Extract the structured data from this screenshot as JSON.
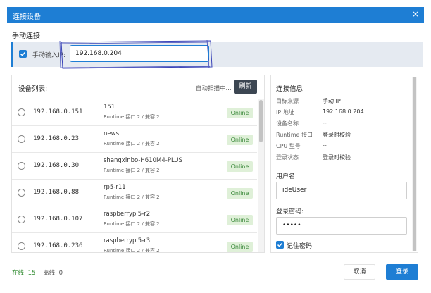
{
  "window": {
    "title": "连接设备",
    "close_glyph": "×"
  },
  "manual": {
    "section_title": "手动连接",
    "checkbox_label": "手动输入IP:",
    "checked": true,
    "ip_value": "192.168.0.204"
  },
  "device_list": {
    "header": "设备列表:",
    "scan_status": "自动扫描中...",
    "refresh_label": "刷新",
    "devices": [
      {
        "ip": "192.168.0.151",
        "name": "151",
        "sub": "Runtime 接口 2 / 兼容 2",
        "status": "Online"
      },
      {
        "ip": "192.168.0.23",
        "name": "news",
        "sub": "Runtime 接口 2 / 兼容 2",
        "status": "Online"
      },
      {
        "ip": "192.168.0.30",
        "name": "shangxinbo-H610M4-PLUS",
        "sub": "Runtime 接口 2 / 兼容 2",
        "status": "Online"
      },
      {
        "ip": "192.168.0.88",
        "name": "rp5-r11",
        "sub": "Runtime 接口 2 / 兼容 2",
        "status": "Online"
      },
      {
        "ip": "192.168.0.107",
        "name": "raspberrypi5-r2",
        "sub": "Runtime 接口 2 / 兼容 2",
        "status": "Online"
      },
      {
        "ip": "192.168.0.236",
        "name": "raspberrypi5-r3",
        "sub": "Runtime 接口 2 / 兼容 2",
        "status": "Online"
      }
    ]
  },
  "connection_info": {
    "header": "连接信息",
    "rows": [
      {
        "key": "目标来源",
        "value": "手动 IP"
      },
      {
        "key": "IP 地址",
        "value": "192.168.0.204"
      },
      {
        "key": "设备名称",
        "value": "--"
      },
      {
        "key": "Runtime 接口",
        "value": "登录时校验"
      },
      {
        "key": "CPU 型号",
        "value": "--"
      },
      {
        "key": "登录状态",
        "value": "登录时校验"
      }
    ],
    "username_label": "用户名:",
    "username_value": "ideUser",
    "password_label": "登录密码:",
    "password_value": "•••••",
    "remember_label": "记住密码",
    "remember_checked": true
  },
  "footer": {
    "online_text": "在线: 15",
    "offline_text": "离线: 0",
    "cancel_label": "取消",
    "login_label": "登录"
  },
  "colors": {
    "accent": "#1e7ed4",
    "online_badge_bg": "#dff0d8",
    "online_badge_text": "#3c8a3c",
    "refresh_button": "#3c4652",
    "sketch_stroke": "#3a44b8"
  }
}
